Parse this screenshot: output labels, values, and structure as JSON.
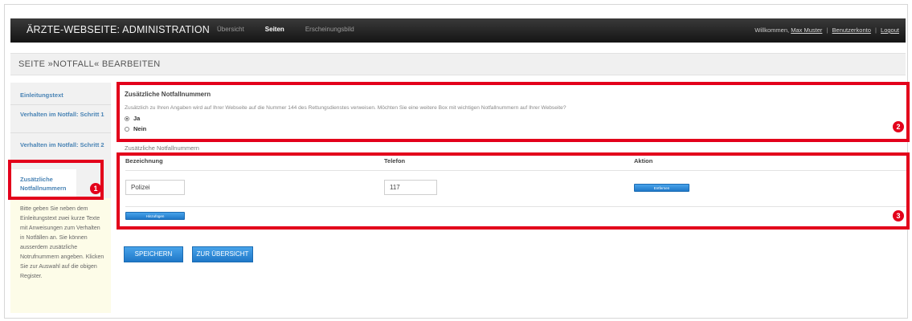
{
  "app": {
    "title": "ÄRZTE-WEBSEITE: ADMINISTRATION",
    "nav": [
      {
        "label": "Übersicht"
      },
      {
        "label": "Seiten"
      },
      {
        "label": "Erscheinungsbild"
      }
    ],
    "active_nav": "Seiten",
    "user": {
      "greeting": "Willkommen,",
      "name": "Max Muster",
      "account_link": "Benutzerkonto",
      "logout_link": "Logout",
      "separator": "|"
    }
  },
  "page": {
    "title": "SEITE »NOTFALL« BEARBEITEN"
  },
  "sidebar": {
    "items": [
      {
        "label": "Einleitungstext"
      },
      {
        "label": "Verhalten im Notfall: Schritt 1"
      },
      {
        "label": "Verhalten im Notfall: Schritt 2"
      },
      {
        "label": "Zusätzliche Notfallnummern"
      }
    ],
    "active_item": "Zusätzliche Notfallnummern",
    "help_text": "Bitte geben Sie neben dem Einleitungstext zwei kurze Texte mit Anweisungen zum Verhalten in Notfällen an. Sie können ausserdem zusätzliche Notrufnummern angeben. Klicken Sie zur Auswahl auf die obigen Register."
  },
  "question": {
    "title": "Zusätzliche Notfallnummern",
    "text": "Zusätzlich zu Ihren Angaben wird auf Ihrer Webseite auf die Nummer 144 des Rettungsdienstes verweisen. Möchten Sie eine weitere Box mit wichtigen Notfallnummern auf Ihrer Webseite?",
    "options": [
      {
        "label": "Ja",
        "checked": true
      },
      {
        "label": "Nein",
        "checked": false
      }
    ]
  },
  "numbers": {
    "section_title": "Zusätzliche Notfallnummern",
    "columns": [
      "Bezeichnung",
      "Telefon",
      "Aktion"
    ],
    "rows": [
      {
        "bezeichnung": "Polizei",
        "telefon": "117",
        "action_label": "Entfernen"
      }
    ],
    "add_label": "Hinzufügen"
  },
  "actions": {
    "save_label": "SPEICHERN",
    "overview_label": "ZUR ÜBERSICHT"
  },
  "annotations": [
    {
      "number": "1"
    },
    {
      "number": "2"
    },
    {
      "number": "3"
    }
  ],
  "colors": {
    "annotation": "#e3001b",
    "button": "#2a8ad8",
    "link": "#4a84b5",
    "help_bg": "#fdfce8"
  }
}
